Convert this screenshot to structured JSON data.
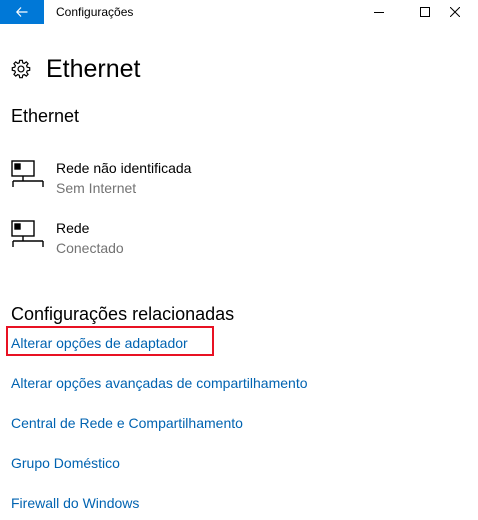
{
  "titlebar": {
    "app_title": "Configurações",
    "back_icon": "arrow-left-icon",
    "minimize_icon": "minimize-icon",
    "maximize_icon": "maximize-icon",
    "close_icon": "close-icon",
    "accent_color": "#0078d7"
  },
  "header": {
    "icon": "gear-icon",
    "title": "Ethernet"
  },
  "ethernet_section": {
    "heading": "Ethernet",
    "networks": [
      {
        "name": "Rede não identificada",
        "status": "Sem Internet",
        "icon": "ethernet-network-icon"
      },
      {
        "name": "Rede",
        "status": "Conectado",
        "icon": "ethernet-network-icon"
      }
    ]
  },
  "related_section": {
    "heading": "Configurações relacionadas",
    "links": [
      "Alterar opções de adaptador",
      "Alterar opções avançadas de compartilhamento",
      "Central de Rede e Compartilhamento",
      "Grupo Doméstico",
      "Firewall do Windows"
    ],
    "link_color": "#0063b1",
    "highlight_color": "#e81123"
  }
}
